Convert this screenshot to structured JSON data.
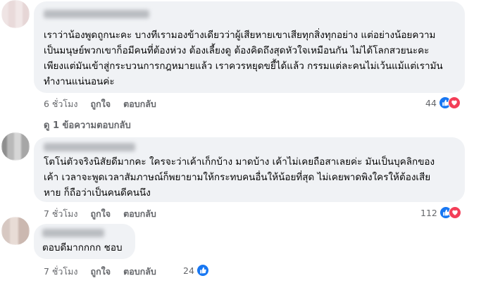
{
  "comments": [
    {
      "lines": [
        "เราว่าน้องพูดถูกนะคะ บางทีเรามองข้างเดียวว่าผู้เสียหายเขาเสียทุกสิ่งทุกอย่าง แต่อย่างน้อยความ",
        "เป็นมนุษย์พวกเขาก็อมีคนที่ต้องห่วง ต้องเลี้ยงดู ต้องคิดถึงสุดหัวใจเหมือนกัน ไม่ได้โลกสวยนะคะ",
        "เพียงแต่มันเข้าสู่กระบวนการกฎหมายแล้ว เราควรหยุดขยี้ได้แล้ว กรรมแต่ละคนไม่เว้นแม้แต่เรามัน",
        "ทำงานแน่นอนค่ะ"
      ],
      "time": "6 ชั่วโมง",
      "like_label": "ถูกใจ",
      "reply_label": "ตอบกลับ",
      "reaction_count": "44",
      "reactions": [
        "like",
        "love"
      ]
    },
    {
      "lines": [
        "โตโน่ตัวจริงนิสัยดีมากคะ ใครจะว่าเค้าเก็กบ้าง มาดบ้าง เค้าไม่เคยถือสาเลยค่ะ มันเป็นบุคลิกของ",
        "เค้า เวลาจะพูดเวลาสัมภาษณ์ก็พยายามให้กระทบคนอื่นให้น้อยที่สุด ไม่เคยพาดพิงใครให้ต้องเสีย",
        "หาย ก็ถือว่าเป็นคนดีคนนึง"
      ],
      "time": "7 ชั่วโมง",
      "like_label": "ถูกใจ",
      "reply_label": "ตอบกลับ",
      "reaction_count": "112",
      "reactions": [
        "like",
        "love"
      ]
    },
    {
      "lines": [
        "ตอบดีมากกกก ชอบ"
      ],
      "time": "7 ชั่วโมง",
      "like_label": "ถูกใจ",
      "reply_label": "ตอบกลับ",
      "reaction_count": "24",
      "reactions": [
        "like"
      ]
    }
  ],
  "replies_link": "ดู 1 ข้อความตอบกลับ",
  "colors": {
    "bubble": "#f0f2f5",
    "meta_text": "#65676b",
    "like_blue": "#1877f2",
    "love_red": "#f33e58"
  }
}
